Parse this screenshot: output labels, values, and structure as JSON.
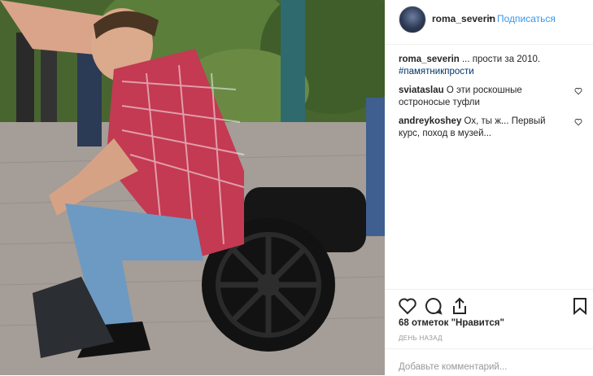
{
  "post": {
    "username": "roma_severin",
    "separator": "•",
    "follow_label": "Подписаться",
    "caption_username": "roma_severin",
    "caption_text": " ... прости за 2010.",
    "caption_tag": "#памятникпрости",
    "comments": [
      {
        "username": "sviataslau",
        "text": " О эти роскошные остроносые туфли"
      },
      {
        "username": "andreykoshey",
        "text": " Ох, ты ж... Первый курс, поход в музей..."
      }
    ],
    "likes_text": "68 отметок \"Нравится\"",
    "time_text": "ДЕНЬ НАЗАД",
    "add_comment_placeholder": "Добавьте комментарий..."
  },
  "icons": {
    "like": "heart-icon",
    "comment": "comment-icon",
    "share": "share-icon",
    "save": "bookmark-icon"
  },
  "colors": {
    "link": "#3897f0",
    "hashtag": "#003569",
    "muted": "#999999",
    "text": "#262626"
  }
}
